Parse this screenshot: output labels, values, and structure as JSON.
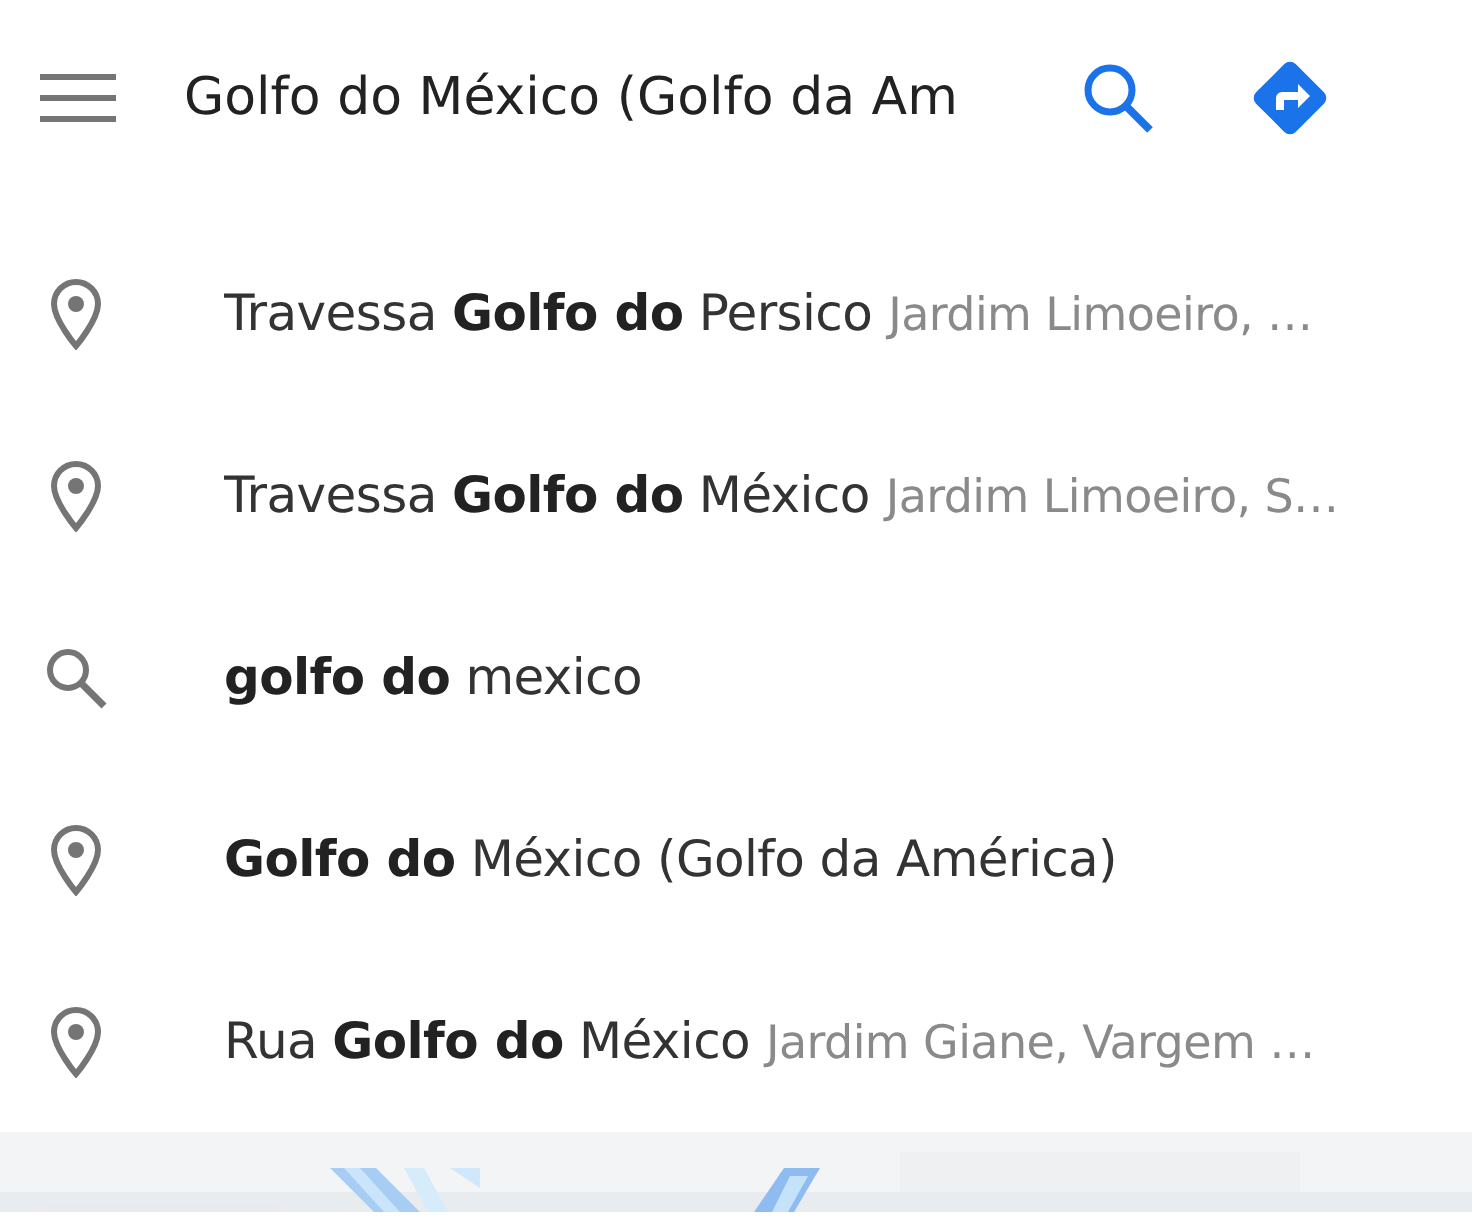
{
  "search_bar": {
    "value": "Golfo do México (Golfo da Am"
  },
  "suggestions": [
    {
      "kind": "place",
      "title": "Travessa **Golfo do** Persico",
      "detail": "Jardim Limoeiro, …"
    },
    {
      "kind": "place",
      "title": "Travessa **Golfo do** México",
      "detail": "Jardim Limoeiro, S…"
    },
    {
      "kind": "query",
      "title": "**golfo do** mexico"
    },
    {
      "kind": "place",
      "title": "**Golfo do** México (Golfo da América)"
    },
    {
      "kind": "place",
      "title": "Rua **Golfo do** México",
      "detail": "Jardim Giane, Vargem …"
    }
  ]
}
